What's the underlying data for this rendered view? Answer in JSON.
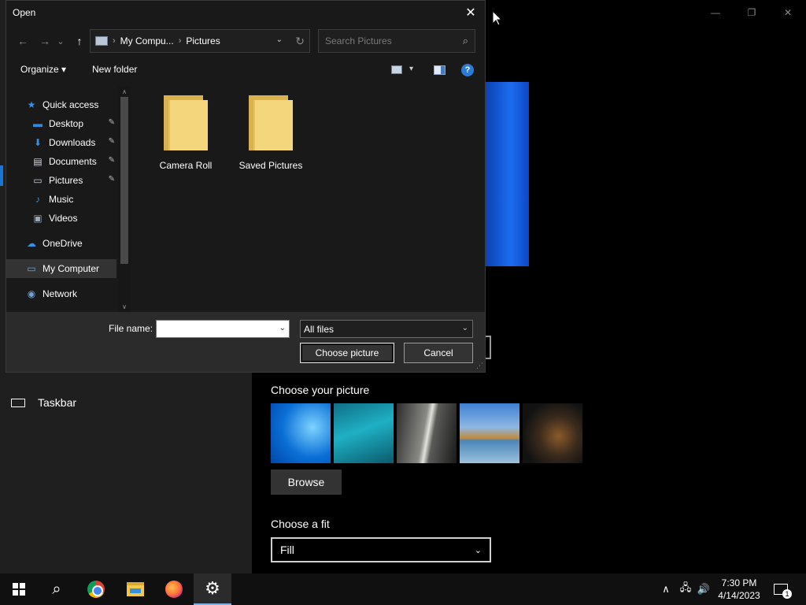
{
  "dialog": {
    "title": "Open",
    "close_glyph": "✕",
    "nav": {
      "back_glyph": "←",
      "forward_glyph": "→",
      "recent_glyph": "⌄",
      "up_glyph": "↑"
    },
    "address": {
      "segments": [
        "My Compu...",
        "Pictures"
      ],
      "separator": "›",
      "dropdown_glyph": "⌄",
      "refresh_glyph": "↻"
    },
    "search": {
      "placeholder": "Search Pictures",
      "icon_glyph": "⌕"
    },
    "toolbar": {
      "organize_label": "Organize ▾",
      "new_folder_label": "New folder",
      "view_dropdown_glyph": "▾",
      "help_glyph": "?"
    },
    "nav_pane": {
      "items": [
        {
          "label": "Quick access",
          "icon": "star-icon",
          "glyph": "★",
          "color": "#3a8ee6"
        },
        {
          "label": "Desktop",
          "icon": "desktop-icon",
          "glyph": "▬",
          "color": "#2f8ad8",
          "pinned": true
        },
        {
          "label": "Downloads",
          "icon": "download-icon",
          "glyph": "⬇",
          "color": "#3a8ee6",
          "pinned": true
        },
        {
          "label": "Documents",
          "icon": "documents-icon",
          "glyph": "▤",
          "color": "#d0d8e2",
          "pinned": true
        },
        {
          "label": "Pictures",
          "icon": "pictures-icon",
          "glyph": "▭",
          "color": "#c0d0e2",
          "pinned": true
        },
        {
          "label": "Music",
          "icon": "music-icon",
          "glyph": "♪",
          "color": "#3a8ee6"
        },
        {
          "label": "Videos",
          "icon": "videos-icon",
          "glyph": "▣",
          "color": "#9aa8b8"
        },
        {
          "label": "OneDrive",
          "icon": "cloud-icon",
          "glyph": "☁",
          "color": "#3a8ee6"
        },
        {
          "label": "My Computer",
          "icon": "computer-icon",
          "glyph": "▭",
          "color": "#6fa3d8",
          "selected": true
        },
        {
          "label": "Network",
          "icon": "network-icon",
          "glyph": "◉",
          "color": "#6fa3d8"
        }
      ],
      "pin_glyph": "📌",
      "scroll_up_glyph": "∧",
      "scroll_down_glyph": "∨"
    },
    "folders": [
      {
        "label": "Camera Roll"
      },
      {
        "label": "Saved Pictures"
      }
    ],
    "bottom": {
      "file_name_label": "File name:",
      "file_name_value": "",
      "file_type_value": "All files",
      "chevron_glyph": "⌄",
      "choose_label": "Choose picture",
      "cancel_label": "Cancel",
      "grip_glyph": "⋰"
    }
  },
  "settings": {
    "window_controls": {
      "minimize": "—",
      "maximize": "❐",
      "close": "✕"
    },
    "taskbar_label": "Taskbar",
    "choose_picture_title": "Choose your picture",
    "browse_label": "Browse",
    "choose_fit_title": "Choose a fit",
    "fit_value": "Fill",
    "fit_chevron": "⌄"
  },
  "taskbar": {
    "search_glyph": "⌕",
    "gear_glyph": "⚙",
    "tray_up_glyph": "∧",
    "network_glyph": "🖧",
    "volume_glyph": "🔊",
    "time": "7:30 PM",
    "date": "4/14/2023",
    "notification_count": "1"
  }
}
